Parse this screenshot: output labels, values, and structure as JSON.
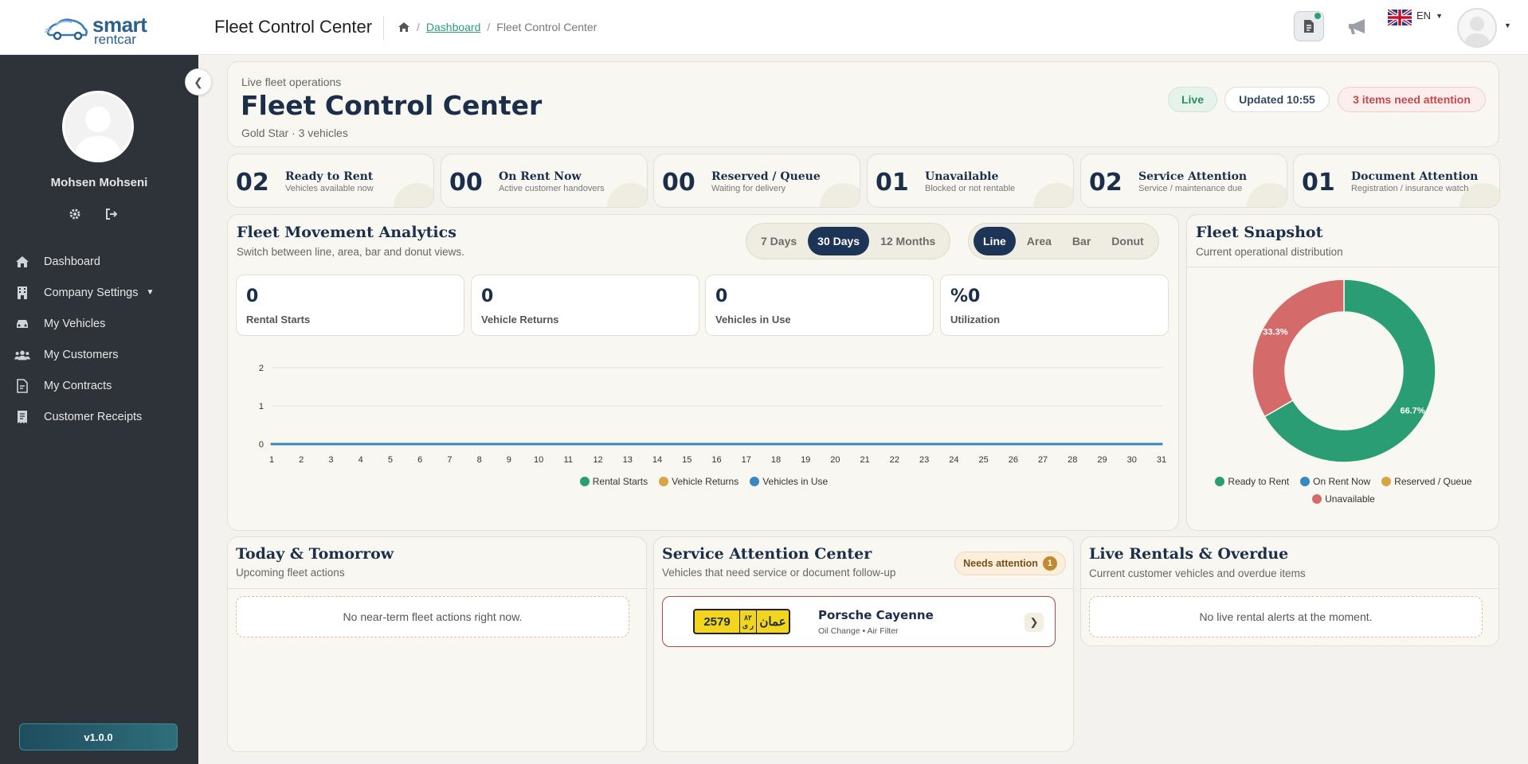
{
  "brand": {
    "line1": "smart",
    "line2": "rentcar"
  },
  "topbar": {
    "page_title": "Fleet Control Center",
    "breadcrumb": {
      "link": "Dashboard",
      "separator": "/",
      "current": "Fleet Control Center"
    },
    "language": "EN"
  },
  "sidebar": {
    "user_name": "Mohsen Mohseni",
    "items": [
      {
        "label": "Dashboard",
        "icon": "home-icon"
      },
      {
        "label": "Company Settings",
        "icon": "building-icon"
      },
      {
        "label": "My Vehicles",
        "icon": "car-icon"
      },
      {
        "label": "My Customers",
        "icon": "users-icon"
      },
      {
        "label": "My Contracts",
        "icon": "file-contract-icon"
      },
      {
        "label": "Customer Receipts",
        "icon": "receipt-icon"
      }
    ],
    "version": "v1.0.0"
  },
  "hero": {
    "eyebrow": "Live fleet operations",
    "title": "Fleet Control Center",
    "subtitle": "Gold Star · 3 vehicles",
    "live": "Live",
    "updated": "Updated 10:55",
    "attention": "3 items need attention"
  },
  "stats": [
    {
      "value": "02",
      "label": "Ready to Rent",
      "desc": "Vehicles available now"
    },
    {
      "value": "00",
      "label": "On Rent Now",
      "desc": "Active customer handovers"
    },
    {
      "value": "00",
      "label": "Reserved / Queue",
      "desc": "Waiting for delivery"
    },
    {
      "value": "01",
      "label": "Unavailable",
      "desc": "Blocked or not rentable"
    },
    {
      "value": "02",
      "label": "Service Attention",
      "desc": "Service / maintenance due"
    },
    {
      "value": "01",
      "label": "Document Attention",
      "desc": "Registration / insurance watch"
    }
  ],
  "analytics": {
    "title": "Fleet Movement Analytics",
    "subtitle": "Switch between line, area, bar and donut views.",
    "ranges": [
      "7 Days",
      "30 Days",
      "12 Months"
    ],
    "active_range": "30 Days",
    "types": [
      "Line",
      "Area",
      "Bar",
      "Donut"
    ],
    "active_type": "Line",
    "metrics": [
      {
        "value": "0",
        "label": "Rental Starts"
      },
      {
        "value": "0",
        "label": "Vehicle Returns"
      },
      {
        "value": "0",
        "label": "Vehicles in Use"
      },
      {
        "value": "%0",
        "label": "Utilization"
      }
    ]
  },
  "snapshot": {
    "title": "Fleet Snapshot",
    "subtitle": "Current operational distribution"
  },
  "today": {
    "title": "Today & Tomorrow",
    "subtitle": "Upcoming fleet actions",
    "empty": "No near-term fleet actions right now."
  },
  "service": {
    "title": "Service Attention Center",
    "subtitle": "Vehicles that need service or document follow-up",
    "badge": "Needs attention",
    "badge_count": "1",
    "item": {
      "plate_number": "2579",
      "plate_code_top": "٨٢",
      "plate_code_bottom": "ر ى",
      "plate_country": "عمان",
      "name": "Porsche Cayenne",
      "desc": "Oil Change • Air Filter"
    }
  },
  "live": {
    "title": "Live Rentals & Overdue",
    "subtitle": "Current customer vehicles and overdue items",
    "empty": "No live rental alerts at the moment."
  },
  "colors": {
    "rental_starts": "#2a9d74",
    "vehicle_returns": "#d9a443",
    "vehicles_in_use": "#3a86c0",
    "ready": "#2a9d74",
    "on_rent": "#3a86c0",
    "reserved": "#d9a443",
    "unavailable": "#d56a6a"
  },
  "chart_data": [
    {
      "type": "line",
      "x": [
        1,
        2,
        3,
        4,
        5,
        6,
        7,
        8,
        9,
        10,
        11,
        12,
        13,
        14,
        15,
        16,
        17,
        18,
        19,
        20,
        21,
        22,
        23,
        24,
        25,
        26,
        27,
        28,
        29,
        30,
        31
      ],
      "series": [
        {
          "name": "Rental Starts",
          "values": [
            0,
            0,
            0,
            0,
            0,
            0,
            0,
            0,
            0,
            0,
            0,
            0,
            0,
            0,
            0,
            0,
            0,
            0,
            0,
            0,
            0,
            0,
            0,
            0,
            0,
            0,
            0,
            0,
            0,
            0,
            0
          ]
        },
        {
          "name": "Vehicle Returns",
          "values": [
            0,
            0,
            0,
            0,
            0,
            0,
            0,
            0,
            0,
            0,
            0,
            0,
            0,
            0,
            0,
            0,
            0,
            0,
            0,
            0,
            0,
            0,
            0,
            0,
            0,
            0,
            0,
            0,
            0,
            0,
            0
          ]
        },
        {
          "name": "Vehicles in Use",
          "values": [
            0,
            0,
            0,
            0,
            0,
            0,
            0,
            0,
            0,
            0,
            0,
            0,
            0,
            0,
            0,
            0,
            0,
            0,
            0,
            0,
            0,
            0,
            0,
            0,
            0,
            0,
            0,
            0,
            0,
            0,
            0
          ]
        }
      ],
      "yticks": [
        0,
        1,
        2
      ],
      "ylim": [
        0,
        2
      ],
      "grid": true,
      "legend": "bottom"
    },
    {
      "type": "pie",
      "categories": [
        "Ready to Rent",
        "On Rent Now",
        "Reserved / Queue",
        "Unavailable"
      ],
      "values": [
        2,
        0,
        0,
        1
      ],
      "data_labels": [
        "66.7%",
        "",
        "",
        "33.3%"
      ],
      "legend": "bottom"
    }
  ]
}
